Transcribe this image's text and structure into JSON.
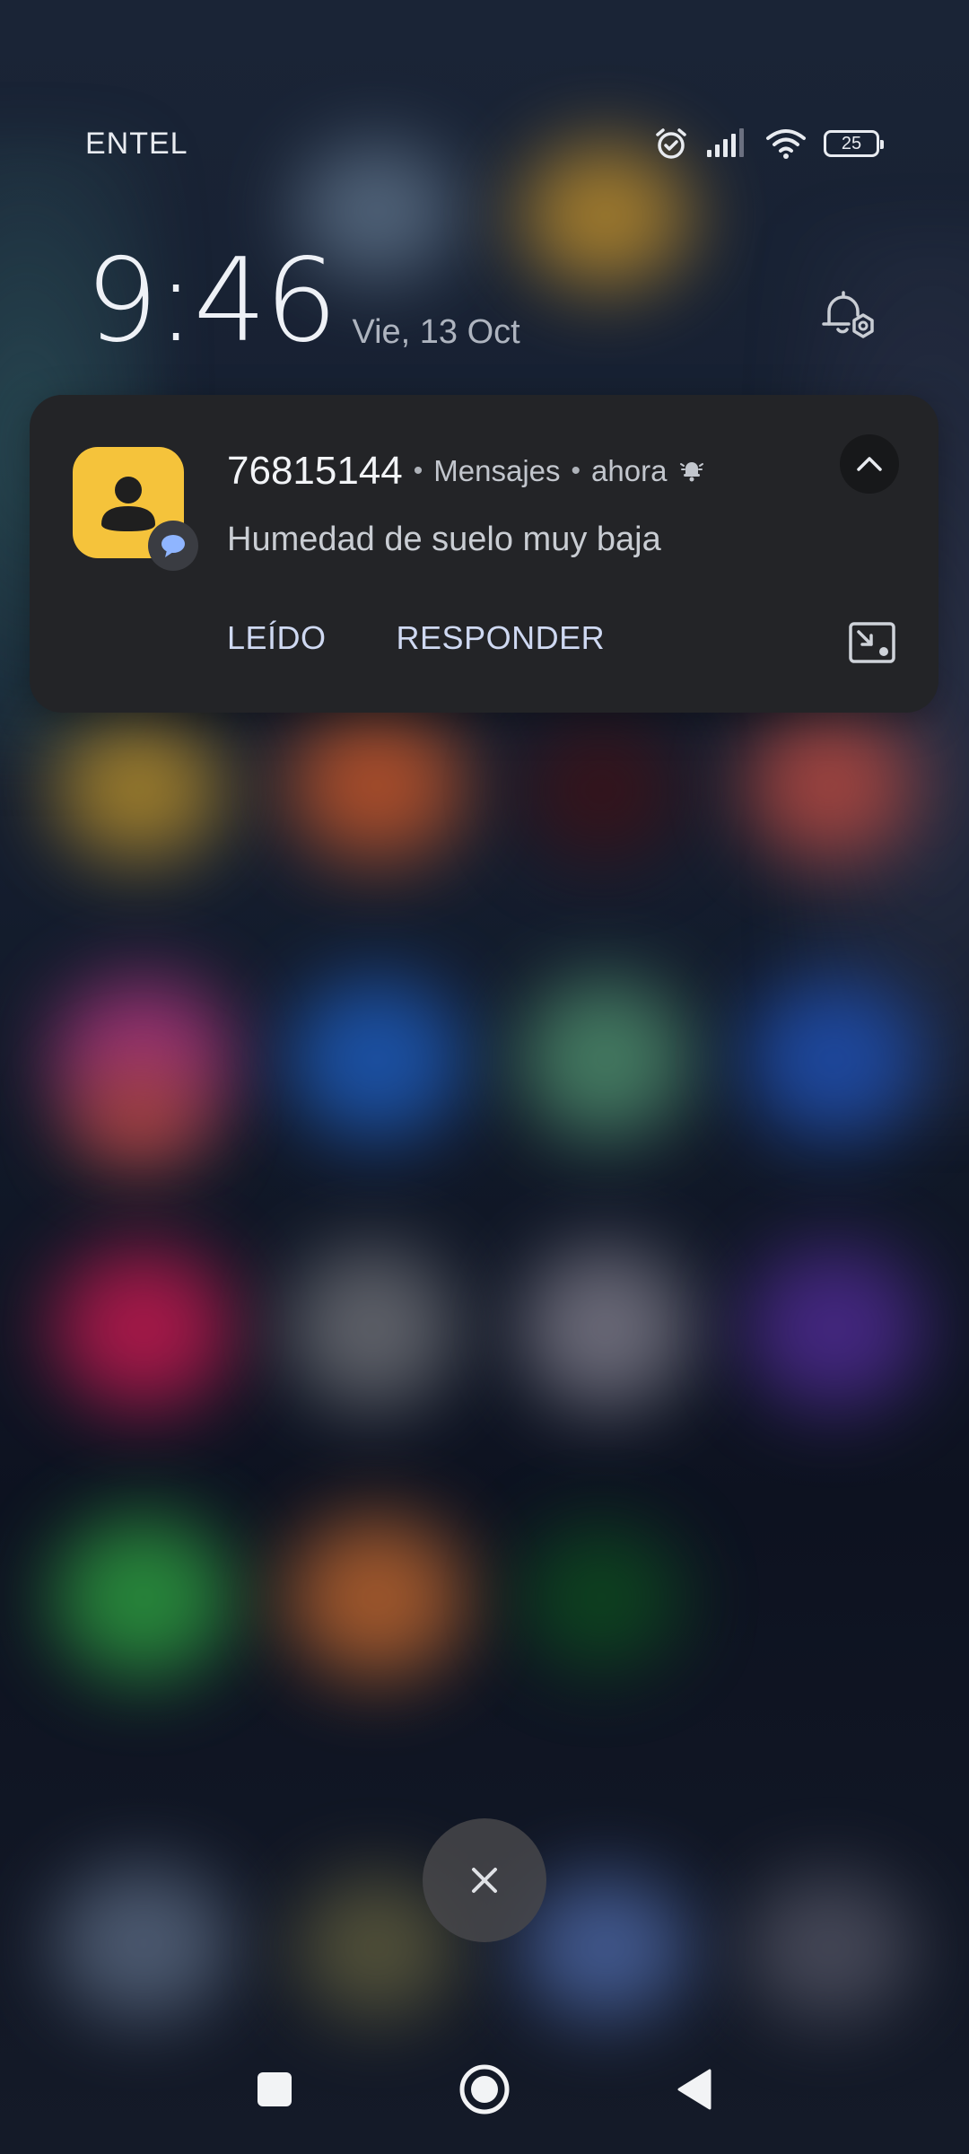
{
  "status_bar": {
    "carrier": "ENTEL",
    "battery_level": "25",
    "icons": [
      "alarm-icon",
      "signal-icon",
      "wifi-icon",
      "battery-icon"
    ]
  },
  "lock_screen": {
    "time": "9:46",
    "date": "Vie, 13 Oct"
  },
  "notification": {
    "sender": "76815144",
    "app_name": "Mensajes",
    "time_ago": "ahora",
    "separator": "•",
    "message": "Humedad de suelo muy baja",
    "actions": [
      {
        "label": "LEÍDO"
      },
      {
        "label": "RESPONDER"
      }
    ],
    "app_icon_color": "#f5c33b"
  },
  "colors": {
    "card_background": "#232427",
    "action_text": "#cfd9f2",
    "badge_accent": "#8fb5ff"
  }
}
